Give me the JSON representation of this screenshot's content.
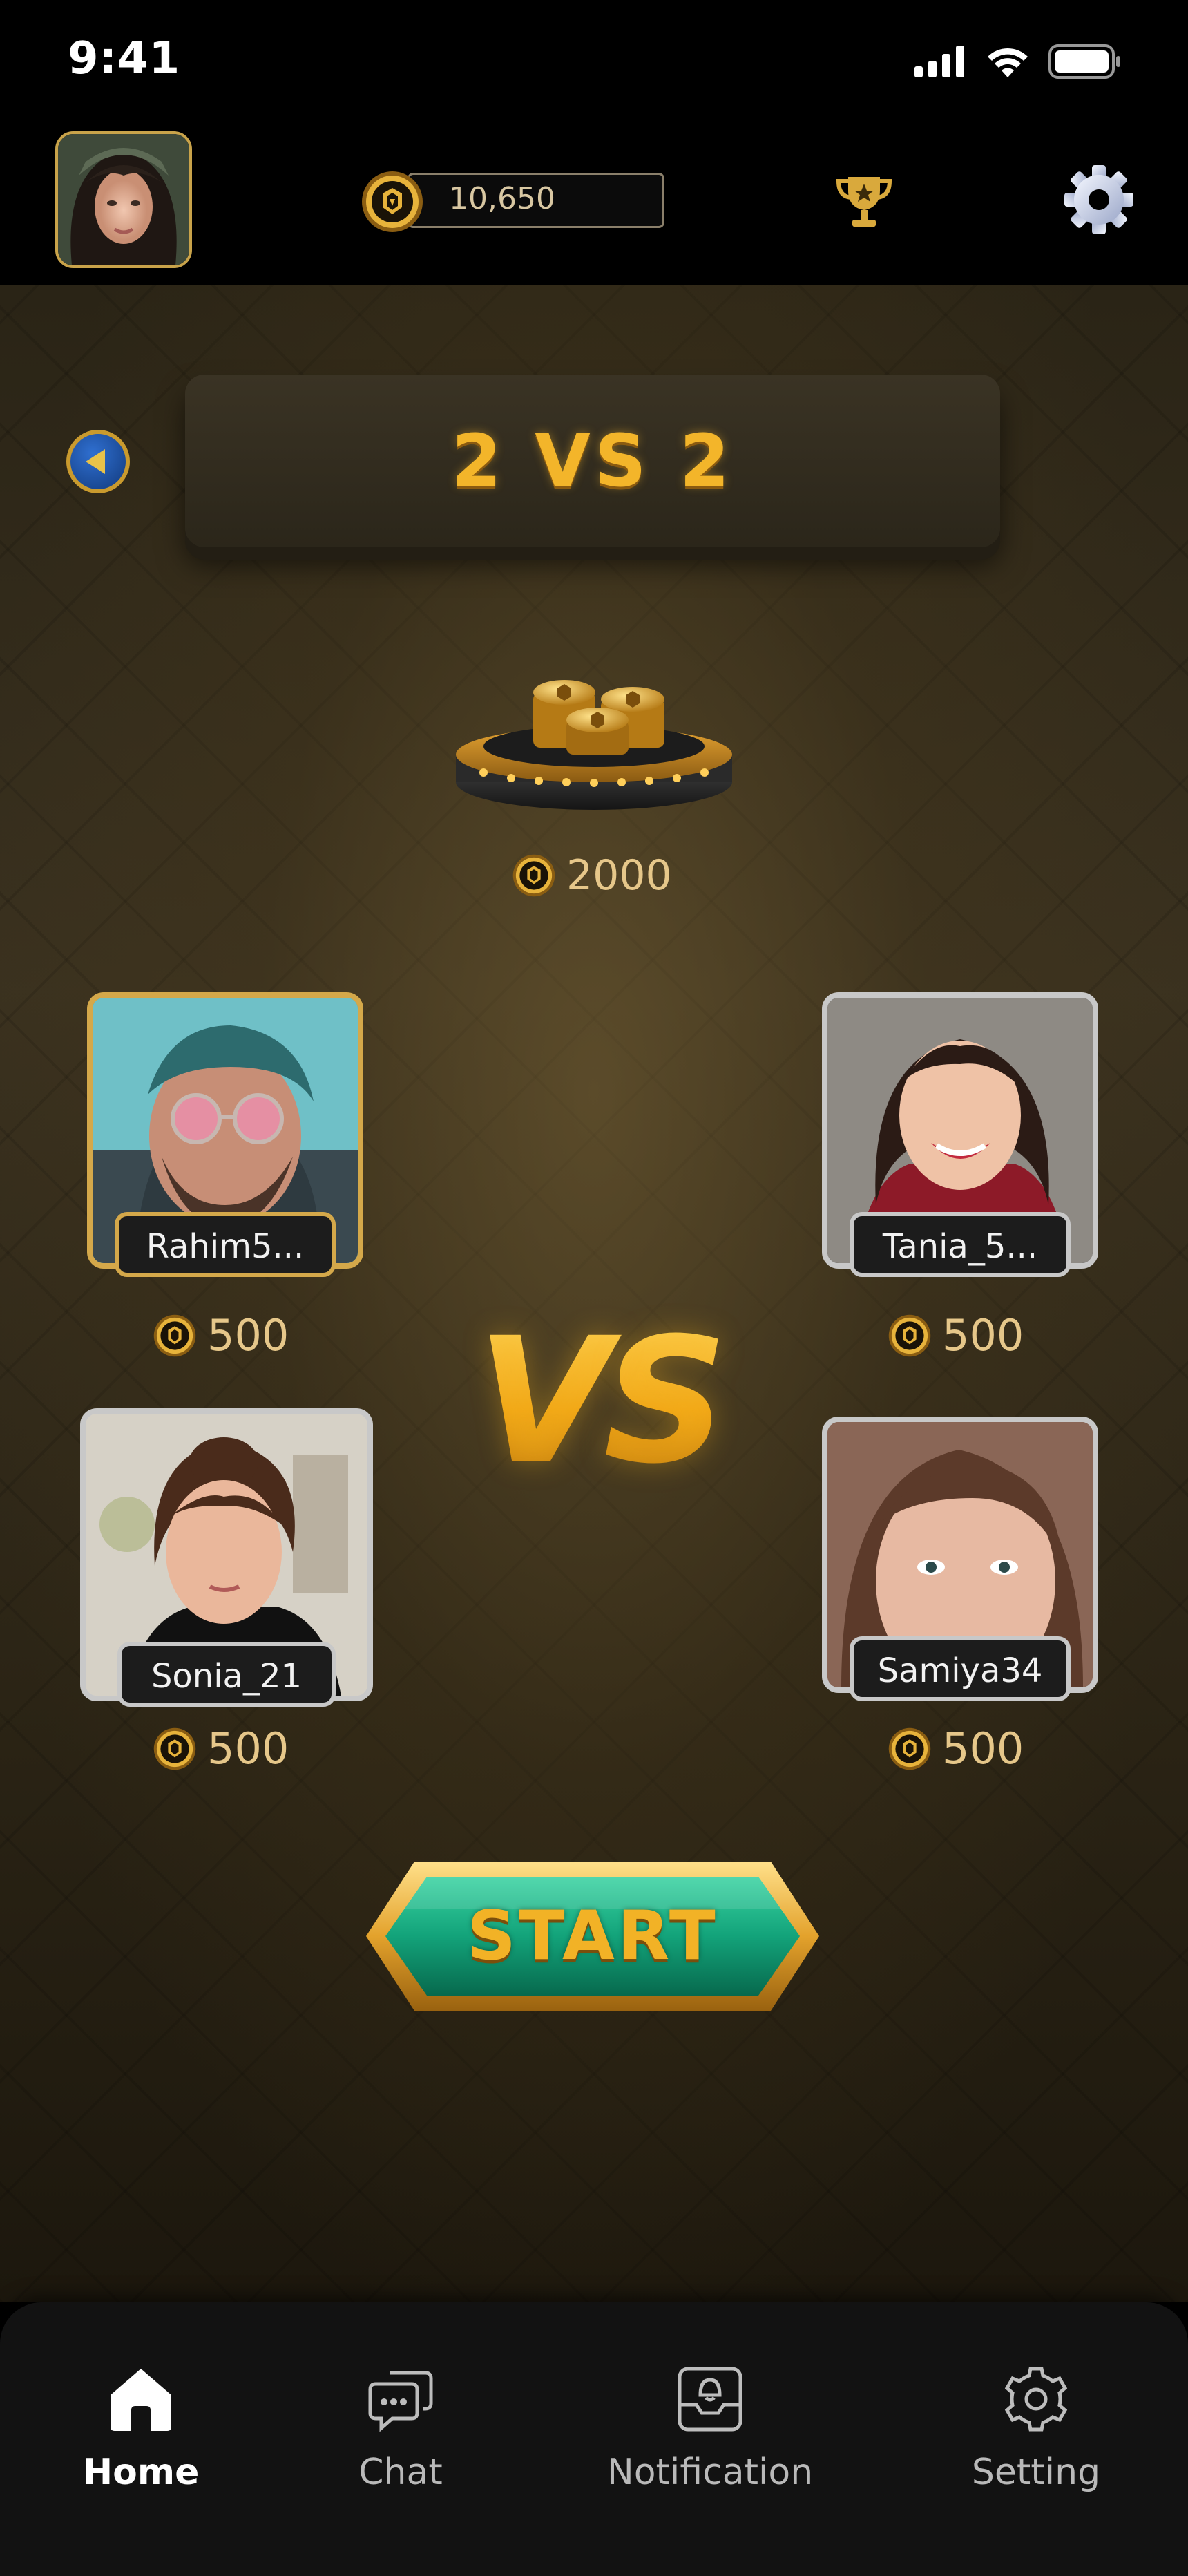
{
  "status_bar": {
    "time": "9:41"
  },
  "top_bar": {
    "coins": "10,650"
  },
  "game": {
    "mode_title": "2 VS 2",
    "pot_amount": "2000",
    "vs_label": "VS",
    "start_label": "START",
    "players": [
      {
        "name": "Rahim5...",
        "bet": "500",
        "frame_color": "#d4a84a"
      },
      {
        "name": "Tania_5...",
        "bet": "500",
        "frame_color": "#c8c8c8"
      },
      {
        "name": "Sonia_21",
        "bet": "500",
        "frame_color": "#c8c8c8"
      },
      {
        "name": "Samiya34",
        "bet": "500",
        "frame_color": "#c8c8c8"
      }
    ]
  },
  "nav": {
    "items": [
      {
        "label": "Home",
        "icon": "home-icon",
        "active": true
      },
      {
        "label": "Chat",
        "icon": "chat-icon",
        "active": false
      },
      {
        "label": "Notification",
        "icon": "notification-icon",
        "active": false
      },
      {
        "label": "Setting",
        "icon": "setting-icon",
        "active": false
      }
    ]
  },
  "colors": {
    "gold": "#f3b52a",
    "background": "#2b2415",
    "nav_bg": "#121212"
  }
}
